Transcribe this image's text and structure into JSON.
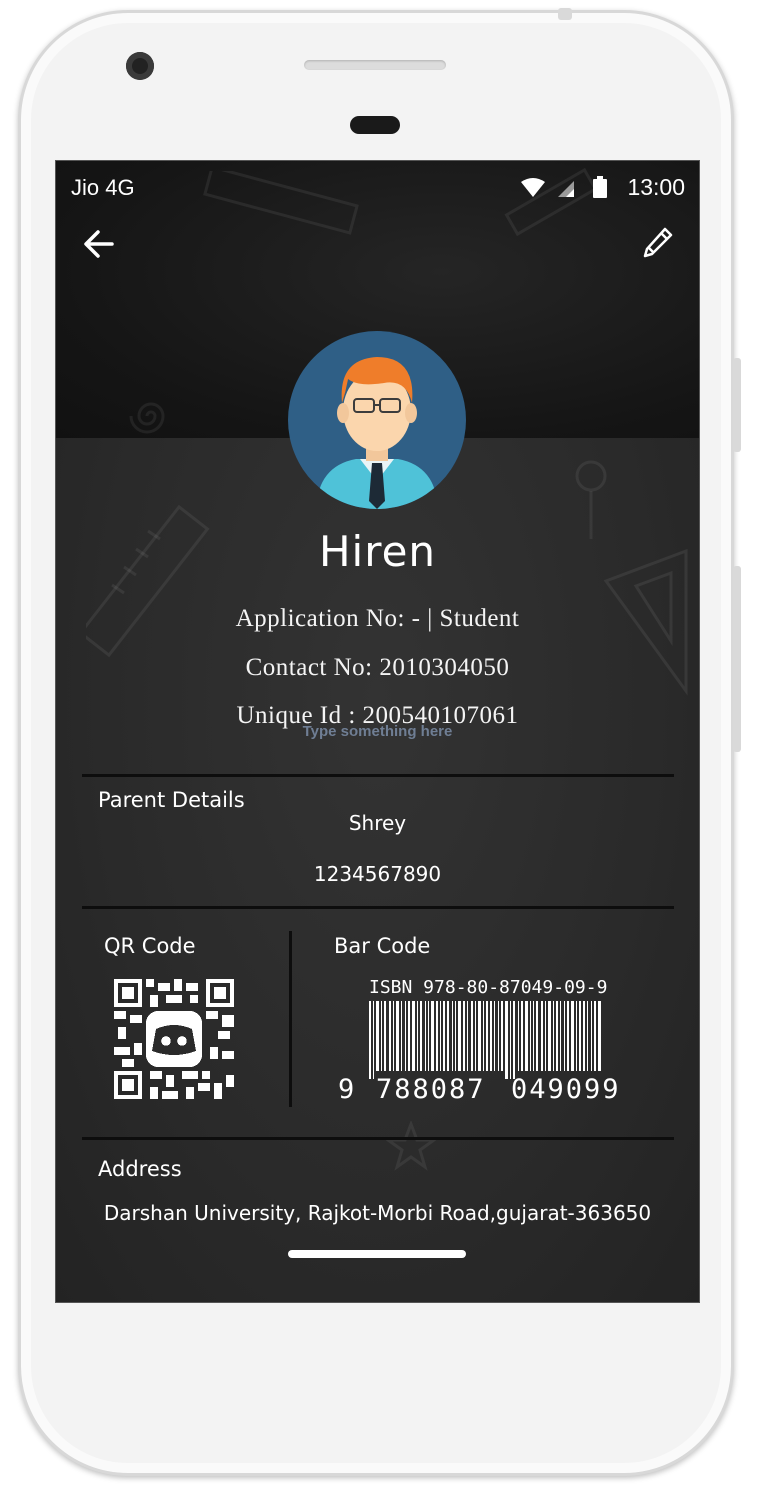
{
  "status_bar": {
    "carrier": "Jio 4G",
    "time": "13:00"
  },
  "icons": {
    "back": "arrow-left-icon",
    "edit": "pencil-icon",
    "wifi": "wifi-icon",
    "signal": "signal-icon",
    "battery": "battery-icon",
    "avatar": "student-avatar-icon",
    "qr": "qr-code-icon",
    "barcode": "barcode-icon"
  },
  "profile": {
    "name": "Hiren",
    "application_line": "Application  No: - | Student",
    "contact_line": "Contact No: 2010304050",
    "unique_id_line": "Unique Id : 200540107061",
    "placeholder": "Type something here"
  },
  "parent": {
    "label": "Parent Details",
    "name": "Shrey",
    "phone": "1234567890"
  },
  "codes": {
    "qr_label": "QR Code",
    "bar_label": "Bar Code",
    "isbn": "ISBN  978-80-87049-09-9",
    "barcode_lead": "9",
    "barcode_group1": "788087",
    "barcode_group2": "049099"
  },
  "address": {
    "label": "Address",
    "value": "Darshan University, Rajkot-Morbi Road,gujarat-363650"
  },
  "colors": {
    "screen_bg": "#2a2a2a",
    "header_bg": "#151515",
    "avatar_bg": "#2f5f86",
    "placeholder": "#6f7e94"
  }
}
